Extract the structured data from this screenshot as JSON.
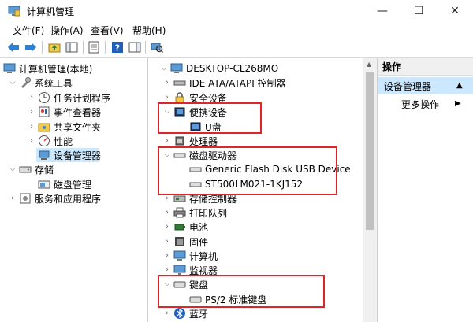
{
  "window": {
    "title": "计算机管理",
    "minimize_glyph": "—",
    "maximize_glyph": "☐",
    "close_glyph": "✕"
  },
  "menu": [
    "文件(F)",
    "操作(A)",
    "查看(V)",
    "帮助(H)"
  ],
  "left_tree": {
    "root": "计算机管理(本地)",
    "system_tools": "系统工具",
    "task_scheduler": "任务计划程序",
    "event_viewer": "事件查看器",
    "shared_folders": "共享文件夹",
    "performance": "性能",
    "device_manager": "设备管理器",
    "storage": "存储",
    "disk_management": "磁盘管理",
    "services_apps": "服务和应用程序"
  },
  "device_tree": {
    "root": "DESKTOP-CL268MO",
    "ide": "IDE ATA/ATAPI 控制器",
    "security": "安全设备",
    "portable": "便携设备",
    "udisk": "U盘",
    "processor": "处理器",
    "disk_drives": "磁盘驱动器",
    "flash_disk": "Generic Flash Disk USB Device",
    "hdd": "ST500LM021-1KJ152",
    "storage_ctrl": "存储控制器",
    "print_queue": "打印队列",
    "battery": "电池",
    "firmware": "固件",
    "computer": "计算机",
    "monitor": "监视器",
    "keyboard": "键盘",
    "ps2_keyboard": "PS/2 标准键盘",
    "bluetooth": "蓝牙"
  },
  "actions": {
    "header": "操作",
    "device_manager": "设备管理器",
    "more": "更多操作"
  },
  "colors": {
    "highlight": "#cce8ff",
    "annotation_red": "#e0242b"
  }
}
